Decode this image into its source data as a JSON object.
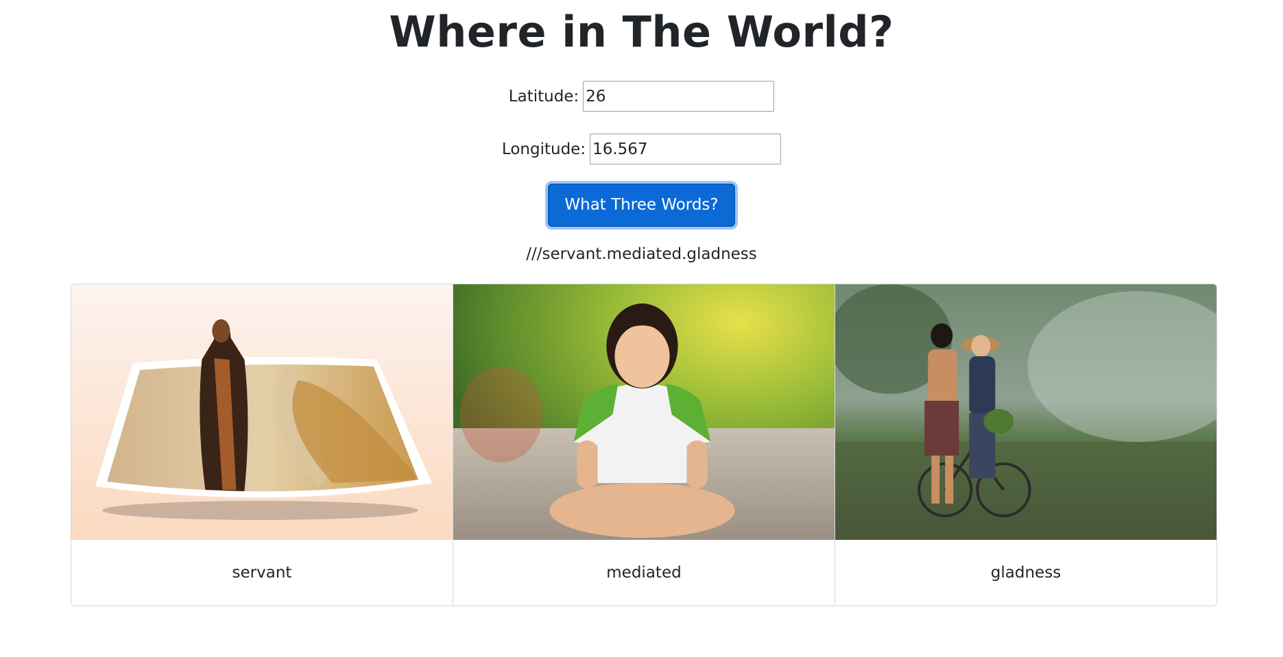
{
  "header": {
    "title": "Where in The World?"
  },
  "form": {
    "latitude_label": "Latitude:",
    "latitude_value": "26",
    "longitude_label": "Longitude:",
    "longitude_value": "16.567",
    "submit_label": "What Three Words?"
  },
  "result": {
    "address": "///servant.mediated.gladness"
  },
  "cards": [
    {
      "word": "servant"
    },
    {
      "word": "mediated"
    },
    {
      "word": "gladness"
    }
  ],
  "colors": {
    "button": "#0b6ad6",
    "button_focus_ring": "#9cc5f4",
    "text": "#212529",
    "card_border": "#d6d8db"
  }
}
